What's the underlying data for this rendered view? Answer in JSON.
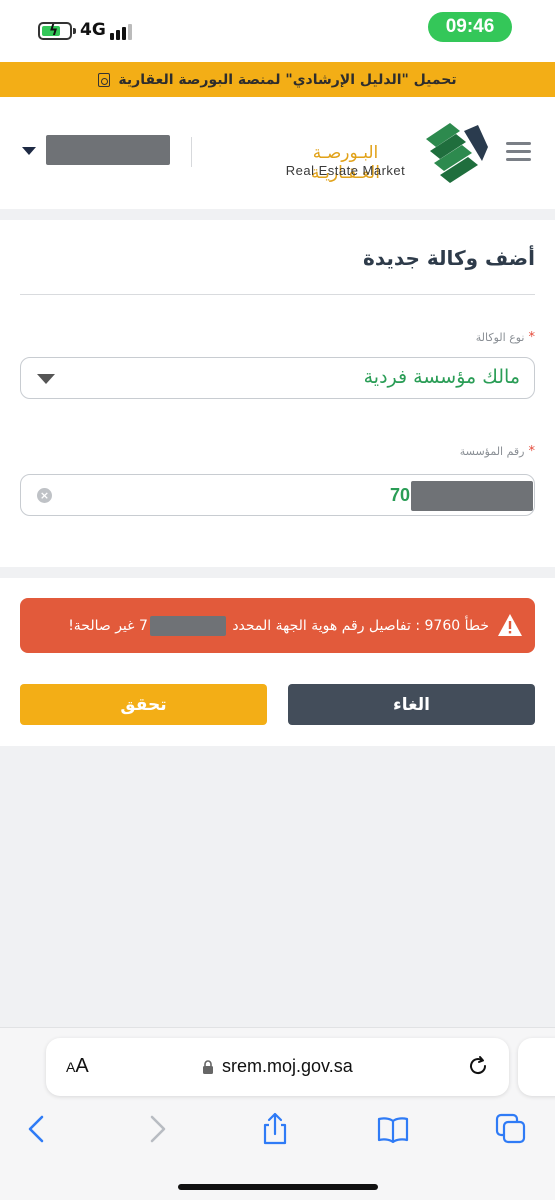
{
  "status_bar": {
    "network": "4G",
    "time": "09:46",
    "battery_level": 0.7
  },
  "banner": {
    "text": "تحميل \"الدليل الإرشادي\" لمنصة البورصة العقارية",
    "icon": "pdf-icon"
  },
  "header": {
    "logo_arabic": "البـورصـة العـقـاريـة",
    "logo_english": "Real Estate Market"
  },
  "form": {
    "title": "أضف وكالة جديدة",
    "agency_type": {
      "label": "نوع الوكالة",
      "value": "مالك مؤسسة فردية"
    },
    "establishment_number": {
      "label": "رقم المؤسسة",
      "value": "70"
    }
  },
  "error": {
    "text_start": "خطأ 9760 : تفاصيل رقم هوية الجهة المحدد",
    "text_mid": "7",
    "text_end": "غير صالحة!"
  },
  "buttons": {
    "cancel": "الغاء",
    "verify": "تحقق"
  },
  "browser": {
    "aa_small": "A",
    "aa_large": "A",
    "url": "srem.moj.gov.sa"
  },
  "colors": {
    "banner": "#f3ae16",
    "accent_green": "#2a9d56",
    "error": "#e25a3b",
    "cancel_button": "#434d5a",
    "verify_button": "#f3ae16",
    "ios_blue": "#2f7bf6"
  }
}
